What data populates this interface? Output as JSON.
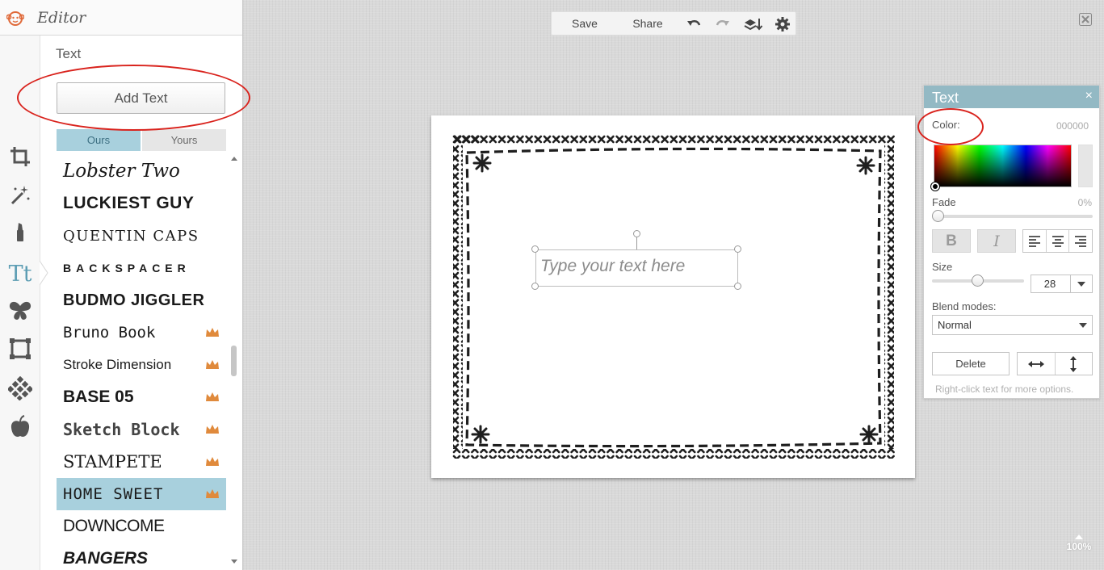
{
  "app": {
    "title": "Editor"
  },
  "panel": {
    "heading": "Text",
    "add_text_label": "Add Text"
  },
  "font_tabs": [
    "Ours",
    "Yours"
  ],
  "fonts": [
    {
      "name": "Lobster Two",
      "premium": false,
      "selected": false
    },
    {
      "name": "LUCKIEST GUY",
      "premium": false,
      "selected": false
    },
    {
      "name": "QUENTIN CAPS",
      "premium": false,
      "selected": false
    },
    {
      "name": "BACKSPACER",
      "premium": false,
      "selected": false
    },
    {
      "name": "BUDMO JIGGLER",
      "premium": false,
      "selected": false
    },
    {
      "name": "Bruno Book",
      "premium": true,
      "selected": false
    },
    {
      "name": "Stroke Dimension",
      "premium": true,
      "selected": false
    },
    {
      "name": "BASE 05",
      "premium": true,
      "selected": false
    },
    {
      "name": "Sketch Block",
      "premium": true,
      "selected": false
    },
    {
      "name": "STAMPETE",
      "premium": true,
      "selected": false
    },
    {
      "name": "HOME SWEET",
      "premium": true,
      "selected": true
    },
    {
      "name": "DOWNCOME",
      "premium": false,
      "selected": false
    },
    {
      "name": "BANGERS",
      "premium": false,
      "selected": false
    }
  ],
  "toolbar": {
    "save_label": "Save",
    "share_label": "Share"
  },
  "canvas": {
    "placeholder": "Type your text here"
  },
  "text_panel": {
    "title": "Text",
    "close": "×",
    "color_label": "Color:",
    "color_value": "000000",
    "fade_label": "Fade",
    "fade_value": "0%",
    "bold_label": "B",
    "italic_label": "I",
    "size_label": "Size",
    "size_value": "28",
    "blend_label": "Blend modes:",
    "blend_value": "Normal",
    "delete_label": "Delete",
    "hint": "Right-click text for more options."
  },
  "zoom": {
    "value": "100%"
  },
  "colors": {
    "accent": "#93b9c4",
    "selected_font_bg": "#a8d0dd",
    "annotation": "#d9231d",
    "crown": "#e08a3c"
  }
}
